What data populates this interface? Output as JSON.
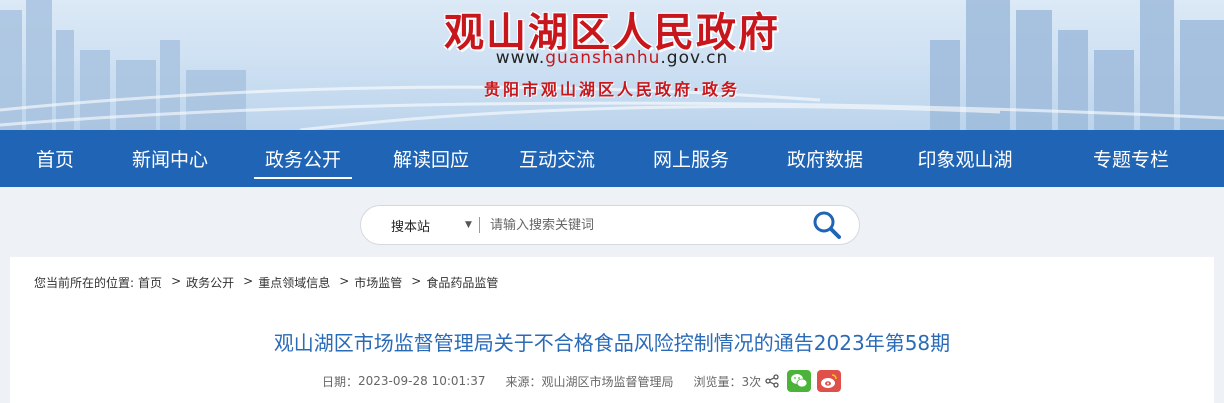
{
  "header": {
    "site_title": "观山湖区人民政府",
    "url_prefix": "www.",
    "url_domain": "guanshanhu",
    "url_suffix": ".gov.cn",
    "subtitle": "贵阳市观山湖区人民政府·政务"
  },
  "nav": {
    "items": [
      {
        "label": "首页"
      },
      {
        "label": "新闻中心"
      },
      {
        "label": "政务公开",
        "active": true
      },
      {
        "label": "解读回应"
      },
      {
        "label": "互动交流"
      },
      {
        "label": "网上服务"
      },
      {
        "label": "政府数据"
      },
      {
        "label": "印象观山湖"
      },
      {
        "label": "专题专栏"
      }
    ]
  },
  "search": {
    "scope": "搜本站",
    "placeholder": "请输入搜索关键词"
  },
  "breadcrumb": {
    "prefix": "您当前所在的位置:",
    "items": [
      "首页",
      "政务公开",
      "重点领域信息",
      "市场监管",
      "食品药品监管"
    ],
    "separator": ">"
  },
  "article": {
    "title": "观山湖区市场监督管理局关于不合格食品风险控制情况的通告2023年第58期",
    "date_label": "日期：",
    "date": "2023-09-28 10:01:37",
    "source_label": "来源：",
    "source": "观山湖区市场监督管理局",
    "views_label": "浏览量：",
    "views": "3次"
  },
  "colors": {
    "nav_bg": "#1f64b5",
    "title_red": "#c8161d",
    "article_title": "#2a6bb8",
    "wechat": "#4cb33a",
    "weibo": "#e0504a"
  }
}
